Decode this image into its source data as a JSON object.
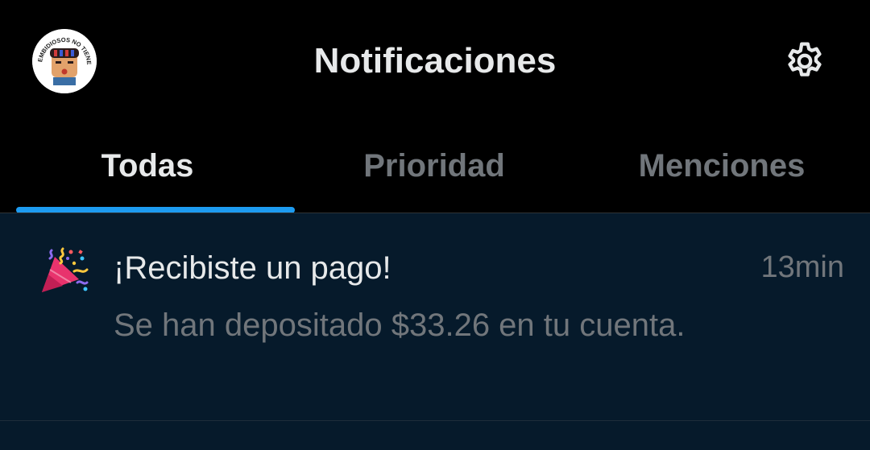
{
  "header": {
    "title": "Notificaciones",
    "avatar_badge_text": "EMBIDIOSOS NO TIENEN AMARO",
    "settings_icon": "gear-icon"
  },
  "tabs": [
    {
      "label": "Todas",
      "active": true
    },
    {
      "label": "Prioridad",
      "active": false
    },
    {
      "label": "Menciones",
      "active": false
    }
  ],
  "notifications": [
    {
      "icon": "party-popper-icon",
      "title": "¡Recibiste un pago!",
      "time": "13min",
      "body": "Se han depositado $33.26 en tu cuenta."
    }
  ],
  "colors": {
    "background": "#000000",
    "accent": "#1d9bf0",
    "notification_unread_bg": "#061a2b",
    "text_primary": "#e7e9ea",
    "text_secondary": "#71767b"
  }
}
